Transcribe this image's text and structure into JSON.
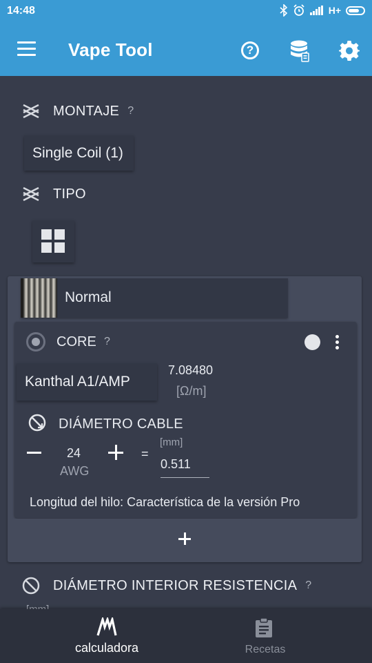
{
  "status_bar": {
    "time": "14:48",
    "network": "H+"
  },
  "app_bar": {
    "title": "Vape Tool",
    "help_glyph": "?"
  },
  "montaje": {
    "label": "MONTAJE",
    "help": "?",
    "value": "Single Coil (1)"
  },
  "tipo": {
    "label": "TIPO"
  },
  "wire_type": {
    "label": "Normal"
  },
  "core": {
    "title": "CORE",
    "help": "?",
    "material": "Kanthal A1/AMP",
    "resistance": "7.08480",
    "resistance_unit": "[Ω/m]",
    "diameter_label": "DIÁMETRO CABLE",
    "gauge_value": "24",
    "gauge_unit": "AWG",
    "equals": "=",
    "mm_unit": "[mm]",
    "mm_value": "0.511",
    "length_text": "Longitud del hilo: Característica de la versión Pro"
  },
  "inner_diameter": {
    "label": "DIÁMETRO INTERIOR RESISTENCIA",
    "help": "?",
    "unit": "[mm]"
  },
  "bottom_nav": [
    {
      "label": "calculadora",
      "icon": "calculator-icon",
      "active": true
    },
    {
      "label": "Recetas",
      "icon": "clipboard-icon",
      "active": false
    }
  ],
  "colors": {
    "primary": "#3a9bd4",
    "background": "#373c4b",
    "card": "#454b5c"
  }
}
